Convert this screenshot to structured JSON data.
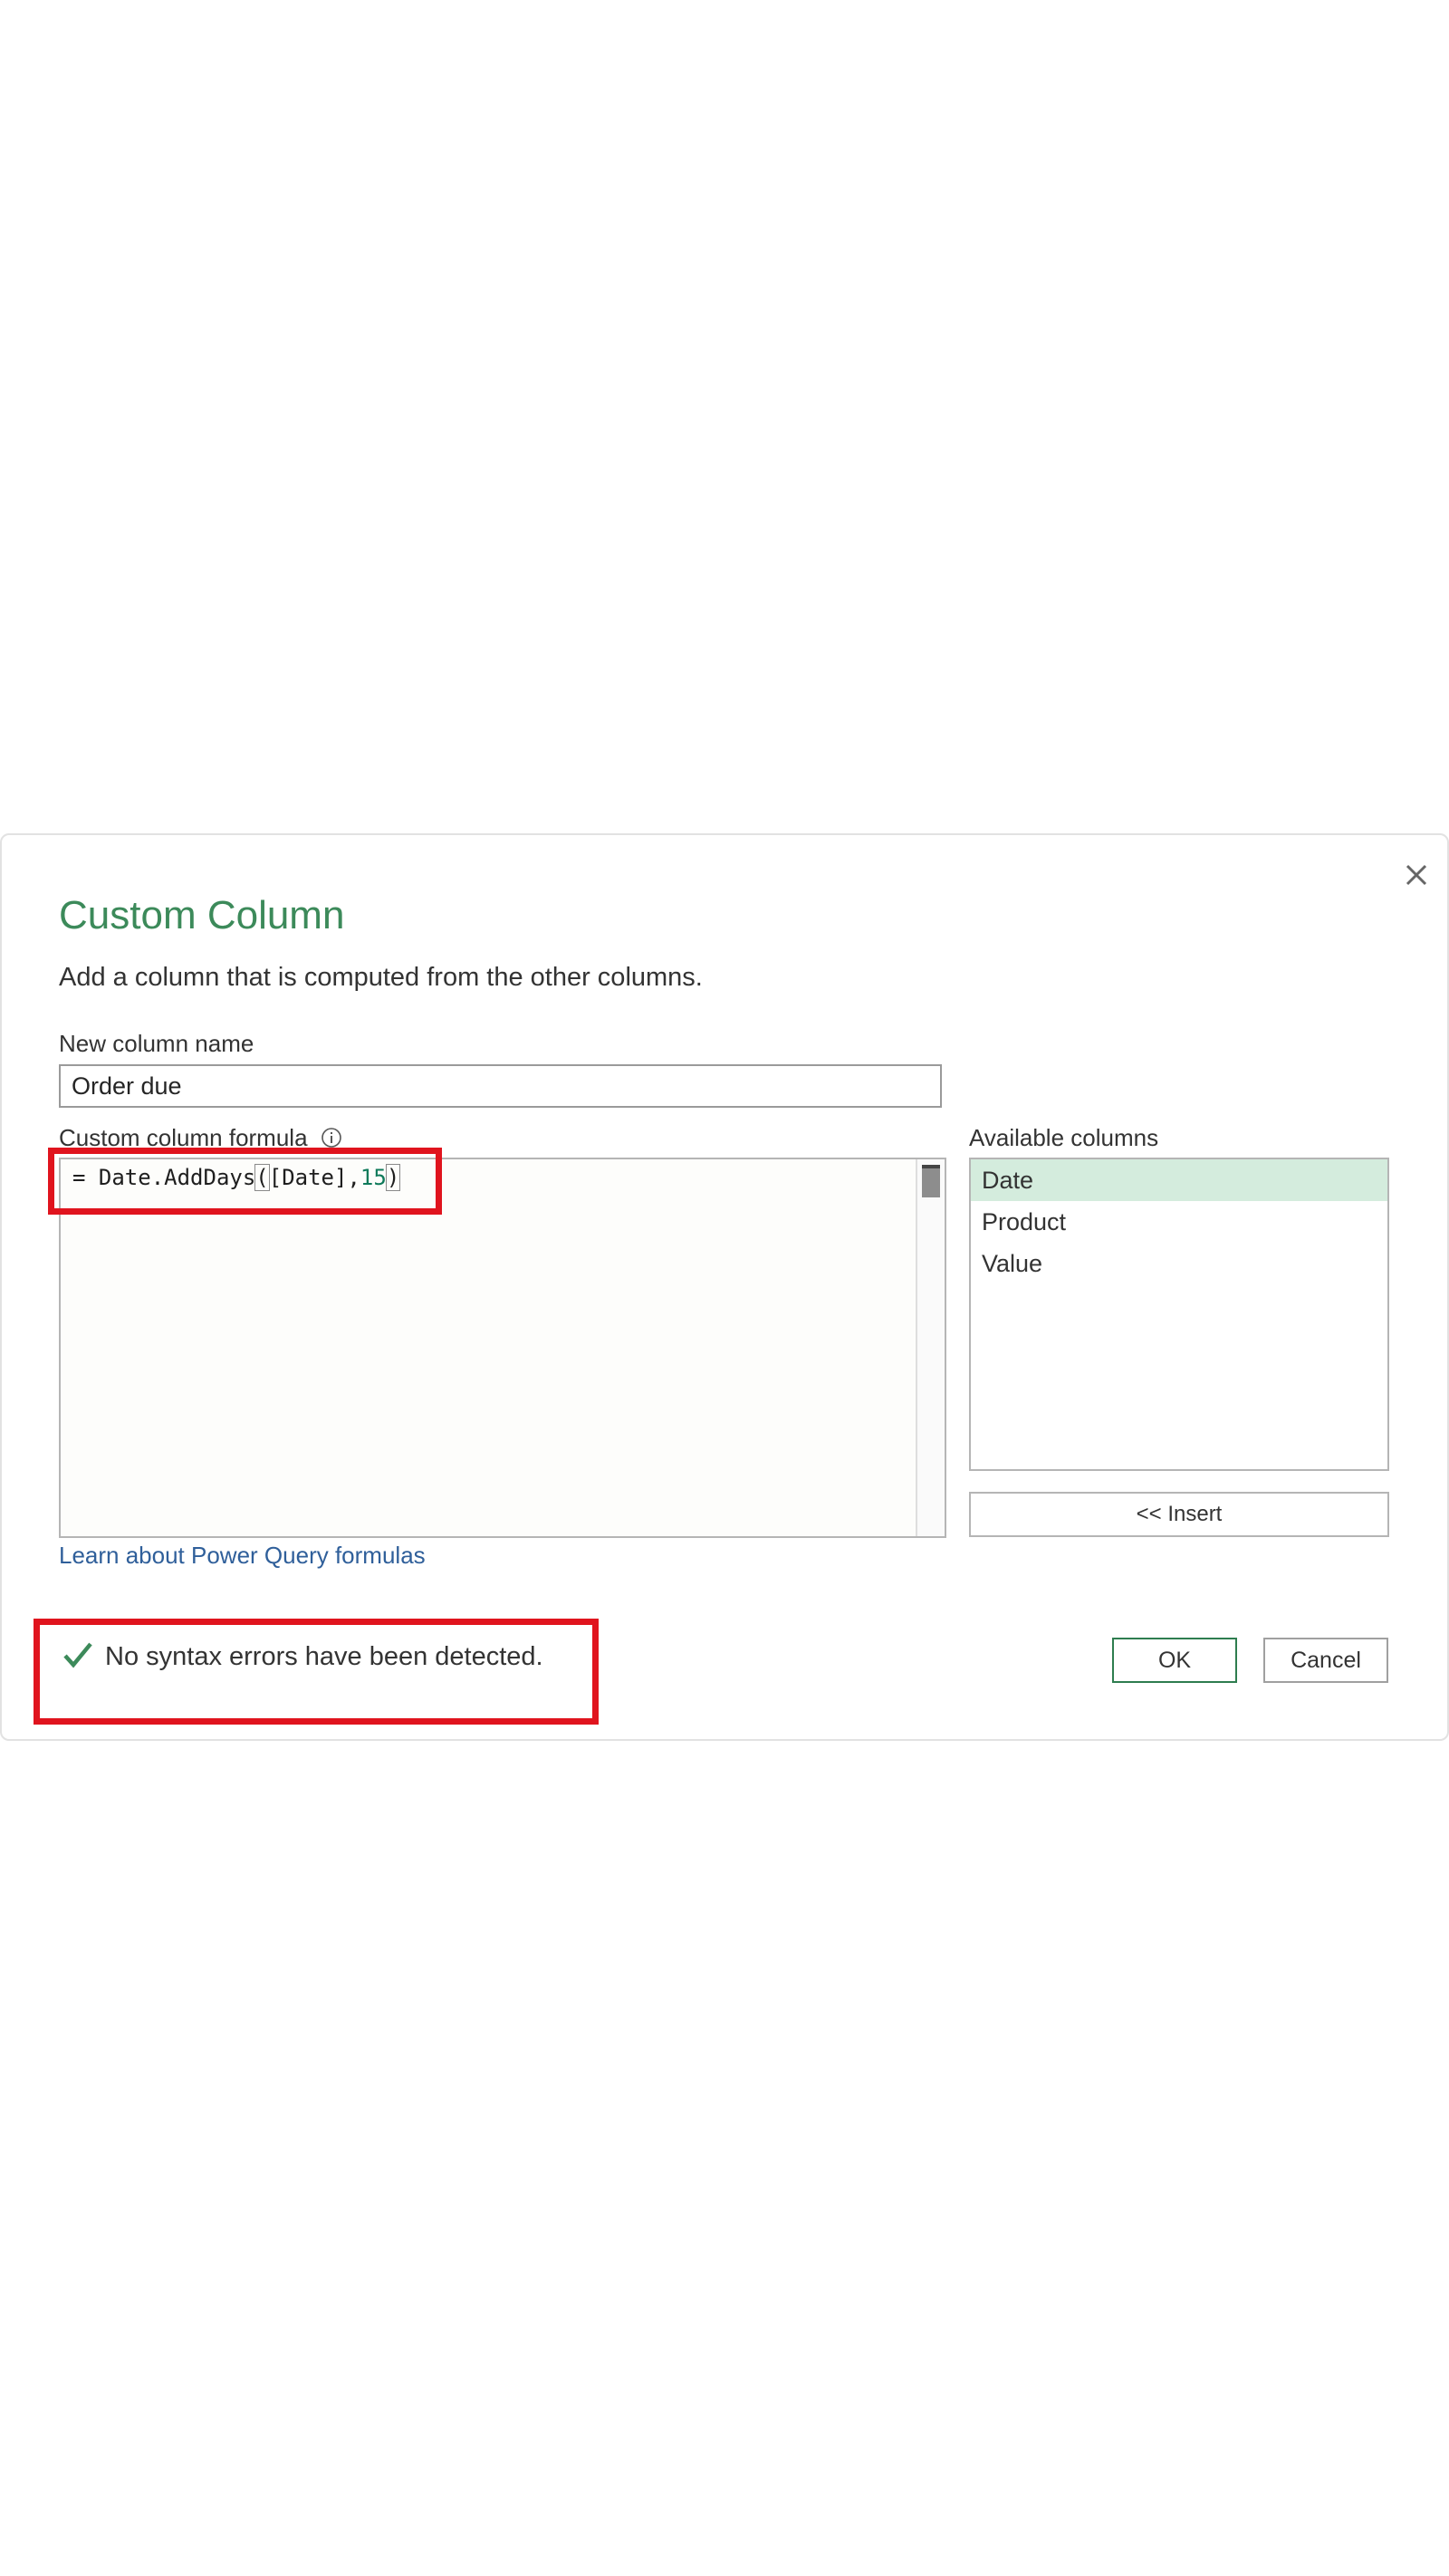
{
  "dialog": {
    "title": "Custom Column",
    "subtitle": "Add a column that is computed from the other columns.",
    "close_icon": "close-icon"
  },
  "new_column": {
    "label": "New column name",
    "value": "Order due"
  },
  "formula": {
    "label": "Custom column formula",
    "info_icon": "info-icon",
    "prefix": "= Date.AddDays",
    "open_paren": "(",
    "args_text": "[Date],",
    "number": "15",
    "close_paren": ")"
  },
  "available_columns": {
    "label": "Available columns",
    "items": [
      "Date",
      "Product",
      "Value"
    ],
    "selected": "Date"
  },
  "buttons": {
    "insert": "<< Insert",
    "ok": "OK",
    "cancel": "Cancel"
  },
  "link": {
    "learn": "Learn about Power Query formulas"
  },
  "status": {
    "icon": "check-icon",
    "text": "No syntax errors have been detected."
  },
  "colors": {
    "title": "#3c8a5a",
    "selected_row": "#d4ecdd",
    "highlight": "#e0141e",
    "link": "#2f5f9a",
    "check": "#3c8a5a"
  }
}
